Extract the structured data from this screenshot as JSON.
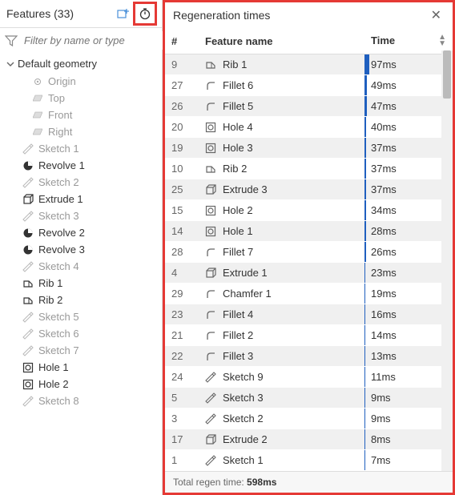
{
  "left": {
    "title": "Features (33)",
    "filter_placeholder": "Filter by name or type",
    "group": "Default geometry",
    "origin": "Origin",
    "planes": [
      "Top",
      "Front",
      "Right"
    ],
    "items": [
      {
        "label": "Sketch 1",
        "icon": "sketch",
        "active": false
      },
      {
        "label": "Revolve 1",
        "icon": "revolve",
        "active": true
      },
      {
        "label": "Sketch 2",
        "icon": "sketch",
        "active": false
      },
      {
        "label": "Extrude 1",
        "icon": "extrude",
        "active": true
      },
      {
        "label": "Sketch 3",
        "icon": "sketch",
        "active": false
      },
      {
        "label": "Revolve 2",
        "icon": "revolve",
        "active": true
      },
      {
        "label": "Revolve 3",
        "icon": "revolve",
        "active": true
      },
      {
        "label": "Sketch 4",
        "icon": "sketch",
        "active": false
      },
      {
        "label": "Rib 1",
        "icon": "rib",
        "active": true
      },
      {
        "label": "Rib 2",
        "icon": "rib",
        "active": true
      },
      {
        "label": "Sketch 5",
        "icon": "sketch",
        "active": false
      },
      {
        "label": "Sketch 6",
        "icon": "sketch",
        "active": false
      },
      {
        "label": "Sketch 7",
        "icon": "sketch",
        "active": false
      },
      {
        "label": "Hole 1",
        "icon": "hole",
        "active": true
      },
      {
        "label": "Hole 2",
        "icon": "hole",
        "active": true
      },
      {
        "label": "Sketch 8",
        "icon": "sketch",
        "active": false
      }
    ]
  },
  "right": {
    "title": "Regeneration times",
    "col_num": "#",
    "col_name": "Feature name",
    "col_time": "Time",
    "footer_label": "Total regen time: ",
    "footer_value": "598ms",
    "max_ms": 97,
    "rows": [
      {
        "num": "9",
        "name": "Rib 1",
        "icon": "rib",
        "ms": 97,
        "time": "97ms"
      },
      {
        "num": "27",
        "name": "Fillet 6",
        "icon": "fillet",
        "ms": 49,
        "time": "49ms"
      },
      {
        "num": "26",
        "name": "Fillet 5",
        "icon": "fillet",
        "ms": 47,
        "time": "47ms"
      },
      {
        "num": "20",
        "name": "Hole 4",
        "icon": "hole",
        "ms": 40,
        "time": "40ms"
      },
      {
        "num": "19",
        "name": "Hole 3",
        "icon": "hole",
        "ms": 37,
        "time": "37ms"
      },
      {
        "num": "10",
        "name": "Rib 2",
        "icon": "rib",
        "ms": 37,
        "time": "37ms"
      },
      {
        "num": "25",
        "name": "Extrude 3",
        "icon": "extrude",
        "ms": 37,
        "time": "37ms"
      },
      {
        "num": "15",
        "name": "Hole 2",
        "icon": "hole",
        "ms": 34,
        "time": "34ms"
      },
      {
        "num": "14",
        "name": "Hole 1",
        "icon": "hole",
        "ms": 28,
        "time": "28ms"
      },
      {
        "num": "28",
        "name": "Fillet 7",
        "icon": "fillet",
        "ms": 26,
        "time": "26ms"
      },
      {
        "num": "4",
        "name": "Extrude 1",
        "icon": "extrude",
        "ms": 23,
        "time": "23ms"
      },
      {
        "num": "29",
        "name": "Chamfer 1",
        "icon": "fillet",
        "ms": 19,
        "time": "19ms"
      },
      {
        "num": "23",
        "name": "Fillet 4",
        "icon": "fillet",
        "ms": 16,
        "time": "16ms"
      },
      {
        "num": "21",
        "name": "Fillet 2",
        "icon": "fillet",
        "ms": 14,
        "time": "14ms"
      },
      {
        "num": "22",
        "name": "Fillet 3",
        "icon": "fillet",
        "ms": 13,
        "time": "13ms"
      },
      {
        "num": "24",
        "name": "Sketch 9",
        "icon": "sketch",
        "ms": 11,
        "time": "11ms"
      },
      {
        "num": "5",
        "name": "Sketch 3",
        "icon": "sketch",
        "ms": 9,
        "time": "9ms"
      },
      {
        "num": "3",
        "name": "Sketch 2",
        "icon": "sketch",
        "ms": 9,
        "time": "9ms"
      },
      {
        "num": "17",
        "name": "Extrude 2",
        "icon": "extrude",
        "ms": 8,
        "time": "8ms"
      },
      {
        "num": "1",
        "name": "Sketch 1",
        "icon": "sketch",
        "ms": 7,
        "time": "7ms"
      }
    ]
  },
  "icons": {
    "sketch": "pencil",
    "revolve": "circle-sector",
    "extrude": "cube",
    "rib": "sheet",
    "hole": "hole-circle",
    "fillet": "round-corner"
  }
}
